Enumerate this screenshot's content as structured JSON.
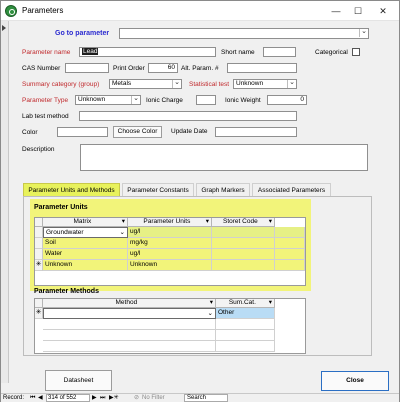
{
  "window": {
    "title": "Parameters",
    "minimize": "—",
    "maximize": "☐",
    "close": "✕"
  },
  "goto": {
    "label": "Go to parameter",
    "value": ""
  },
  "form": {
    "parameter_name": {
      "label": "Parameter name",
      "value": "Lead"
    },
    "short_name": {
      "label": "Short name",
      "value": ""
    },
    "categorical": {
      "label": "Categorical",
      "checked": false
    },
    "cas_number": {
      "label": "CAS Number",
      "value": ""
    },
    "print_order": {
      "label": "Print Order",
      "value": "60"
    },
    "alt_param": {
      "label": "Alt. Param. #",
      "value": ""
    },
    "summary_category": {
      "label": "Summary category (group)",
      "value": "Metals"
    },
    "statistical_test": {
      "label": "Statistical test",
      "value": "Unknown"
    },
    "parameter_type": {
      "label": "Parameter Type",
      "value": "Unknown"
    },
    "ionic_charge": {
      "label": "Ionic Charge",
      "value": ""
    },
    "ionic_weight": {
      "label": "Ionic Weight",
      "value": "0"
    },
    "lab_test_method": {
      "label": "Lab test method",
      "value": ""
    },
    "color": {
      "label": "Color",
      "value": ""
    },
    "choose_color": "Choose Color",
    "update_date": {
      "label": "Update Date",
      "value": ""
    },
    "description": {
      "label": "Description",
      "value": ""
    }
  },
  "tabs": [
    "Parameter Units and Methods",
    "Parameter Constants",
    "Graph Markers",
    "Associated Parameters"
  ],
  "units": {
    "title": "Parameter Units",
    "headers": [
      "Matrix",
      "Parameter Units",
      "Storet Code"
    ],
    "rows": [
      {
        "matrix": "Groundwater",
        "units": "ug/l",
        "storet": ""
      },
      {
        "matrix": "Soil",
        "units": "mg/kg",
        "storet": ""
      },
      {
        "matrix": "Water",
        "units": "ug/l",
        "storet": ""
      },
      {
        "matrix": "Unknown",
        "units": "Unknown",
        "storet": ""
      }
    ]
  },
  "methods": {
    "title": "Parameter Methods",
    "headers": [
      "Method",
      "Sum.Cat."
    ],
    "rows": [
      {
        "method": "",
        "sumcat": "Other"
      }
    ]
  },
  "buttons": {
    "datasheet": "Datasheet",
    "close": "Close"
  },
  "record_nav": {
    "label": "Record:",
    "position": "314 of 552",
    "filter": "No Filter",
    "search": "Search"
  },
  "colors": {
    "highlight": "#f2f47a",
    "accent_red": "#c0292c",
    "link_blue": "#2a2ad0"
  }
}
